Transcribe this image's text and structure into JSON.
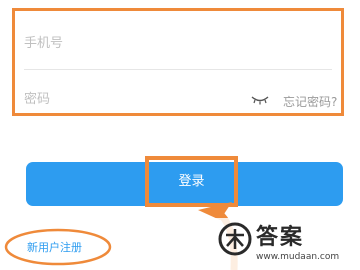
{
  "login_form": {
    "phone_placeholder": "手机号",
    "password_placeholder": "密码",
    "forgot_password": "忘记密码?",
    "password_visibility_icon": "eye-closed-icon"
  },
  "actions": {
    "login_label": "登录",
    "register_link": "新用户注册"
  },
  "watermark": {
    "title": "答案",
    "url": "www.mudaan.com"
  },
  "colors": {
    "highlight": "#ef8a3a",
    "primary": "#2d9cf0"
  }
}
